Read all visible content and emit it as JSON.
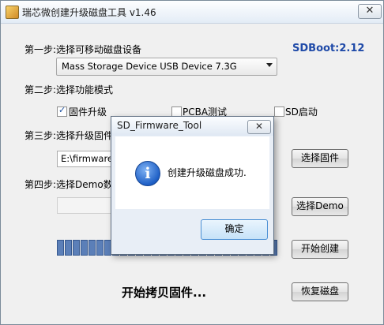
{
  "window": {
    "title": "瑞芯微创建升级磁盘工具 v1.46",
    "close_glyph": "✕"
  },
  "version_label": "SDBoot:2.12",
  "step1": {
    "label": "第一步:选择可移动磁盘设备",
    "device_selected": "Mass Storage Device USB Device   7.3G"
  },
  "step2": {
    "label": "第二步:选择功能模式",
    "options": [
      {
        "label": "固件升级",
        "checked": true
      },
      {
        "label": "PCBA测试",
        "checked": false
      },
      {
        "label": "SD启动",
        "checked": false
      }
    ]
  },
  "step3": {
    "label": "第三步:选择升级固件",
    "firmware_path": "E:\\firmware\\A",
    "button": "选择固件"
  },
  "step4": {
    "label": "第四步:选择Demo数据",
    "demo_path": "",
    "button": "选择Demo"
  },
  "buttons": {
    "start_create": "开始创建",
    "restore_disk": "恢复磁盘"
  },
  "progress": {
    "filled_segments": 28
  },
  "status_text": "开始拷贝固件...",
  "dialog": {
    "title": "SD_Firmware_Tool",
    "message": "创建升级磁盘成功.",
    "ok_button": "确定",
    "close_glyph": "✕",
    "icon": "info-icon"
  },
  "colors": {
    "progress": "#5b7fb8",
    "accent": "#1f4aa8"
  }
}
